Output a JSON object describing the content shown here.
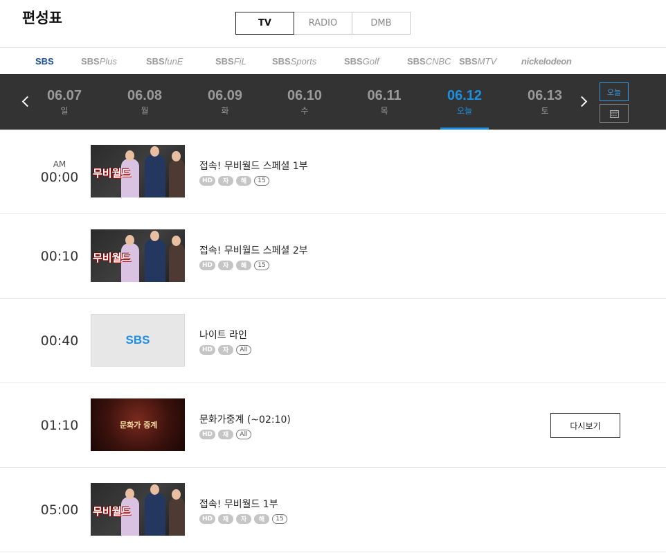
{
  "page_title": "편성표",
  "media_tabs": [
    {
      "label": "TV",
      "active": true
    },
    {
      "label": "RADIO",
      "active": false
    },
    {
      "label": "DMB",
      "active": false
    }
  ],
  "channels": [
    {
      "name": "SBS",
      "sub": "",
      "active": true
    },
    {
      "name": "SBS",
      "sub": "Plus",
      "active": false
    },
    {
      "name": "SBS",
      "sub": "funE",
      "active": false
    },
    {
      "name": "SBS",
      "sub": "FiL",
      "active": false
    },
    {
      "name": "SBS",
      "sub": "Sports",
      "active": false
    },
    {
      "name": "SBS",
      "sub": "Golf",
      "active": false
    },
    {
      "name": "SBS",
      "sub": "CNBC",
      "active": false
    },
    {
      "name": "SBS",
      "sub": "MTV",
      "active": false
    },
    {
      "name": "nickelodeon",
      "sub": "",
      "active": false
    }
  ],
  "dates": [
    {
      "date": "06.07",
      "weekday": "일",
      "active": false
    },
    {
      "date": "06.08",
      "weekday": "월",
      "active": false
    },
    {
      "date": "06.09",
      "weekday": "화",
      "active": false
    },
    {
      "date": "06.10",
      "weekday": "수",
      "active": false
    },
    {
      "date": "06.11",
      "weekday": "목",
      "active": false
    },
    {
      "date": "06.12",
      "weekday": "오늘",
      "active": true
    },
    {
      "date": "06.13",
      "weekday": "토",
      "active": false
    }
  ],
  "today_button": "오늘",
  "calendar_icon": "calendar-icon",
  "programs": [
    {
      "ampm": "AM",
      "time": "00:00",
      "title": "접속! 무비월드 스페셜 1부",
      "thumb": "movieworld",
      "thumb_logo": "무비월드",
      "badges": [
        {
          "t": "HD"
        },
        {
          "t": "자"
        },
        {
          "t": "해"
        },
        {
          "t": "15",
          "outline": true
        }
      ],
      "replay": ""
    },
    {
      "ampm": "",
      "time": "00:10",
      "title": "접속! 무비월드 스페셜 2부",
      "thumb": "movieworld",
      "thumb_logo": "무비월드",
      "badges": [
        {
          "t": "HD"
        },
        {
          "t": "자"
        },
        {
          "t": "해"
        },
        {
          "t": "15",
          "outline": true
        }
      ],
      "replay": ""
    },
    {
      "ampm": "",
      "time": "00:40",
      "title": "나이트 라인",
      "thumb": "sbs",
      "thumb_logo": "SBS",
      "badges": [
        {
          "t": "HD"
        },
        {
          "t": "자"
        },
        {
          "t": "All",
          "outline": true
        }
      ],
      "replay": ""
    },
    {
      "ampm": "",
      "time": "01:10",
      "title": "문화가중계 (~02:10)",
      "thumb": "culture",
      "thumb_logo": "문화가 중계",
      "badges": [
        {
          "t": "HD"
        },
        {
          "t": "재"
        },
        {
          "t": "All",
          "outline": true
        }
      ],
      "replay": "다시보기"
    },
    {
      "ampm": "",
      "time": "05:00",
      "title": "접속! 무비월드 1부",
      "thumb": "movieworld",
      "thumb_logo": "무비월드",
      "badges": [
        {
          "t": "HD"
        },
        {
          "t": "재"
        },
        {
          "t": "자"
        },
        {
          "t": "해"
        },
        {
          "t": "15",
          "outline": true
        }
      ],
      "replay": ""
    }
  ]
}
